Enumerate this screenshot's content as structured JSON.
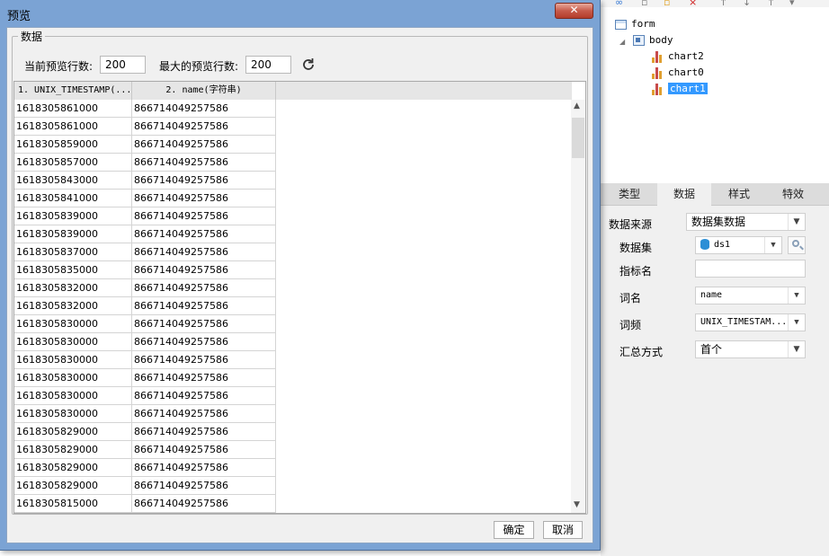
{
  "dialog": {
    "title": "预览",
    "close_label": "✕",
    "group_label": "数据",
    "current_rows_label": "当前预览行数:",
    "current_rows_value": "200",
    "max_rows_label": "最大的预览行数:",
    "max_rows_value": "200",
    "confirm_label": "确定",
    "cancel_label": "取消"
  },
  "grid": {
    "columns": [
      "1. UNIX_TIMESTAMP(...",
      "2. name(字符串)"
    ],
    "rows": [
      [
        "1618305861000",
        "866714049257586"
      ],
      [
        "1618305861000",
        "866714049257586"
      ],
      [
        "1618305859000",
        "866714049257586"
      ],
      [
        "1618305857000",
        "866714049257586"
      ],
      [
        "1618305843000",
        "866714049257586"
      ],
      [
        "1618305841000",
        "866714049257586"
      ],
      [
        "1618305839000",
        "866714049257586"
      ],
      [
        "1618305839000",
        "866714049257586"
      ],
      [
        "1618305837000",
        "866714049257586"
      ],
      [
        "1618305835000",
        "866714049257586"
      ],
      [
        "1618305832000",
        "866714049257586"
      ],
      [
        "1618305832000",
        "866714049257586"
      ],
      [
        "1618305830000",
        "866714049257586"
      ],
      [
        "1618305830000",
        "866714049257586"
      ],
      [
        "1618305830000",
        "866714049257586"
      ],
      [
        "1618305830000",
        "866714049257586"
      ],
      [
        "1618305830000",
        "866714049257586"
      ],
      [
        "1618305830000",
        "866714049257586"
      ],
      [
        "1618305829000",
        "866714049257586"
      ],
      [
        "1618305829000",
        "866714049257586"
      ],
      [
        "1618305829000",
        "866714049257586"
      ],
      [
        "1618305829000",
        "866714049257586"
      ],
      [
        "1618305815000",
        "866714049257586"
      ]
    ]
  },
  "tree": {
    "form": "form",
    "body": "body",
    "items": [
      "chart2",
      "chart0",
      "chart1"
    ],
    "selected": "chart1"
  },
  "props": {
    "tabs": [
      "类型",
      "数据",
      "样式",
      "特效"
    ],
    "active_tab": "数据",
    "data_source_label": "数据来源",
    "data_source_value": "数据集数据",
    "dataset_label": "数据集",
    "dataset_value": "ds1",
    "indicator_label": "指标名",
    "indicator_value": "",
    "word_label": "词名",
    "word_value": "name",
    "freq_label": "词频",
    "freq_value": "UNIX_TIMESTAM...",
    "summary_label": "汇总方式",
    "summary_value": "首个"
  },
  "colors": {
    "title_bar": "#7ba3d4",
    "close_button": "#c75b4b",
    "selection": "#3399ff"
  },
  "icons": [
    "close-icon",
    "refresh-icon",
    "database-icon",
    "search-icon",
    "chart-icon",
    "form-icon",
    "body-icon",
    "chevron-down-icon",
    "chevron-up-icon"
  ]
}
